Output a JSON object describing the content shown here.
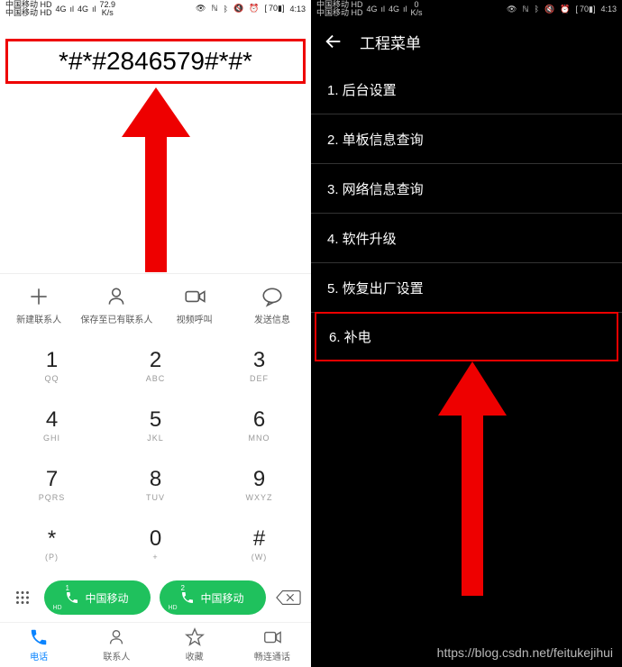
{
  "status": {
    "carrier_line1": "中国移动 HD",
    "carrier_line2": "中国移动 HD",
    "signal1": "4G",
    "signal2": "4G",
    "speed_value": "72.9",
    "speed_value_right": "0",
    "speed_unit": "K/s",
    "battery": "70",
    "time": "4:13"
  },
  "dialer": {
    "display": "*#*#2846579#*#*",
    "actions": {
      "new_contact": "新建联系人",
      "save_contact": "保存至已有联系人",
      "video_call": "视频呼叫",
      "send_msg": "发送信息"
    },
    "keypad": [
      [
        {
          "main": "1",
          "sub": "QQ"
        },
        {
          "main": "2",
          "sub": "ABC"
        },
        {
          "main": "3",
          "sub": "DEF"
        }
      ],
      [
        {
          "main": "4",
          "sub": "GHI"
        },
        {
          "main": "5",
          "sub": "JKL"
        },
        {
          "main": "6",
          "sub": "MNO"
        }
      ],
      [
        {
          "main": "7",
          "sub": "PQRS"
        },
        {
          "main": "8",
          "sub": "TUV"
        },
        {
          "main": "9",
          "sub": "WXYZ"
        }
      ],
      [
        {
          "main": "*",
          "sub": "(P)"
        },
        {
          "main": "0",
          "sub": "+"
        },
        {
          "main": "#",
          "sub": "(W)"
        }
      ]
    ],
    "call_btn1_label": "中国移动",
    "call_btn1_num": "1",
    "call_btn2_label": "中国移动",
    "call_btn2_num": "2",
    "call_hd": "HD",
    "nav": {
      "phone": "电话",
      "contacts": "联系人",
      "favorites": "收藏",
      "smooth": "畅连通话"
    }
  },
  "menu": {
    "title": "工程菜单",
    "items": [
      {
        "idx": "1",
        "label": "后台设置",
        "hl": false
      },
      {
        "idx": "2",
        "label": "单板信息查询",
        "hl": false
      },
      {
        "idx": "3",
        "label": "网络信息查询",
        "hl": false
      },
      {
        "idx": "4",
        "label": "软件升级",
        "hl": false
      },
      {
        "idx": "5",
        "label": "恢复出厂设置",
        "hl": false
      },
      {
        "idx": "6",
        "label": "补电",
        "hl": true
      }
    ]
  },
  "watermark": "https://blog.csdn.net/feitukejihui"
}
